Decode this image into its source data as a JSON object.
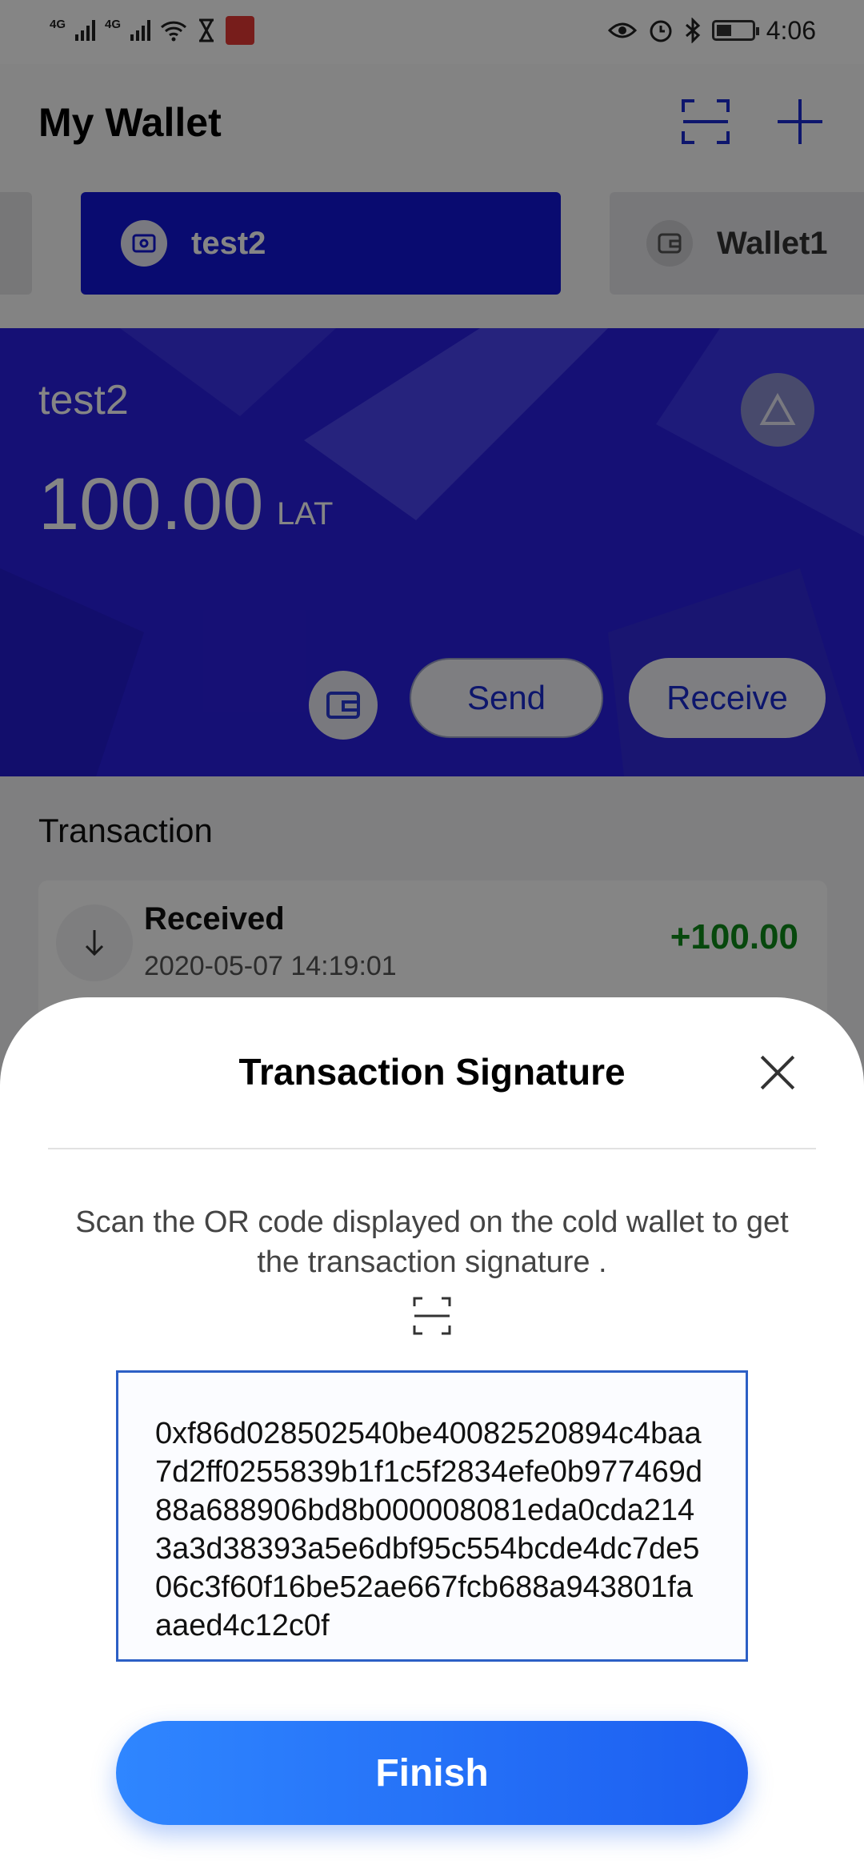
{
  "status_bar": {
    "network_1": "4G",
    "network_2": "4G",
    "time": "4:06",
    "icons": [
      "signal-icon",
      "wifi-icon",
      "hourglass-icon",
      "app-notification-icon",
      "eye-icon",
      "alarm-icon",
      "bluetooth-icon",
      "battery-icon"
    ]
  },
  "header": {
    "title": "My Wallet",
    "scan_icon": "scan-icon",
    "add_icon": "plus-icon"
  },
  "wallet_tabs": [
    {
      "label": "test2",
      "active": true,
      "icon": "cold-wallet-icon"
    },
    {
      "label": "Wallet1",
      "active": false,
      "icon": "wallet-icon"
    }
  ],
  "wallet_card": {
    "name": "test2",
    "balance": "100.00",
    "unit": "LAT",
    "logo_icon": "platon-logo-icon",
    "send_label": "Send",
    "receive_label": "Receive"
  },
  "transactions": {
    "heading": "Transaction",
    "items": [
      {
        "type": "Received",
        "date": "2020-05-07 14:19:01",
        "amount": "+100.00",
        "icon": "arrow-down-icon"
      }
    ]
  },
  "modal": {
    "title": "Transaction Signature",
    "instructions": "Scan the OR code displayed on the cold wallet to get the transaction signature .",
    "signature": "0xf86d028502540be40082520894c4baa7d2ff0255839b1f1c5f2834efe0b977469d88a688906bd8b000008081eda0cda2143a3d38393a5e6dbf95c554bcde4dc7de506c3f60f16be52ae667fcb688a943801faaaed4c12c0f",
    "finish_label": "Finish"
  },
  "colors": {
    "brand_blue": "#1316d6",
    "button_blue": "#1c5ef0",
    "positive_green": "#0f8a1a"
  }
}
